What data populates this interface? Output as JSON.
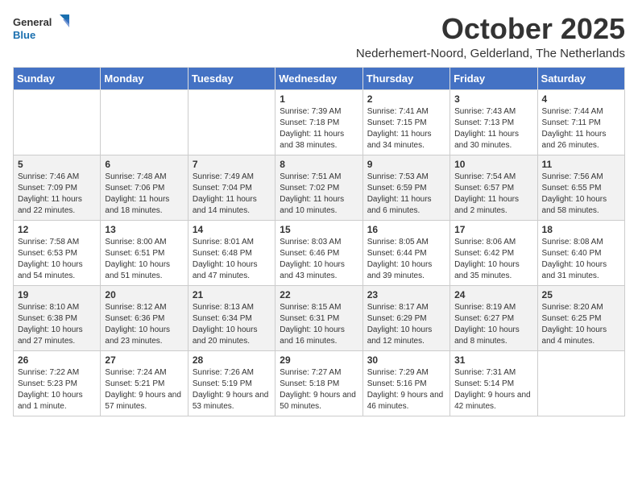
{
  "header": {
    "logo_general": "General",
    "logo_blue": "Blue",
    "month_title": "October 2025",
    "subtitle": "Nederhemert-Noord, Gelderland, The Netherlands"
  },
  "days_of_week": [
    "Sunday",
    "Monday",
    "Tuesday",
    "Wednesday",
    "Thursday",
    "Friday",
    "Saturday"
  ],
  "weeks": [
    [
      {
        "day": "",
        "info": ""
      },
      {
        "day": "",
        "info": ""
      },
      {
        "day": "",
        "info": ""
      },
      {
        "day": "1",
        "info": "Sunrise: 7:39 AM\nSunset: 7:18 PM\nDaylight: 11 hours and 38 minutes."
      },
      {
        "day": "2",
        "info": "Sunrise: 7:41 AM\nSunset: 7:15 PM\nDaylight: 11 hours and 34 minutes."
      },
      {
        "day": "3",
        "info": "Sunrise: 7:43 AM\nSunset: 7:13 PM\nDaylight: 11 hours and 30 minutes."
      },
      {
        "day": "4",
        "info": "Sunrise: 7:44 AM\nSunset: 7:11 PM\nDaylight: 11 hours and 26 minutes."
      }
    ],
    [
      {
        "day": "5",
        "info": "Sunrise: 7:46 AM\nSunset: 7:09 PM\nDaylight: 11 hours and 22 minutes."
      },
      {
        "day": "6",
        "info": "Sunrise: 7:48 AM\nSunset: 7:06 PM\nDaylight: 11 hours and 18 minutes."
      },
      {
        "day": "7",
        "info": "Sunrise: 7:49 AM\nSunset: 7:04 PM\nDaylight: 11 hours and 14 minutes."
      },
      {
        "day": "8",
        "info": "Sunrise: 7:51 AM\nSunset: 7:02 PM\nDaylight: 11 hours and 10 minutes."
      },
      {
        "day": "9",
        "info": "Sunrise: 7:53 AM\nSunset: 6:59 PM\nDaylight: 11 hours and 6 minutes."
      },
      {
        "day": "10",
        "info": "Sunrise: 7:54 AM\nSunset: 6:57 PM\nDaylight: 11 hours and 2 minutes."
      },
      {
        "day": "11",
        "info": "Sunrise: 7:56 AM\nSunset: 6:55 PM\nDaylight: 10 hours and 58 minutes."
      }
    ],
    [
      {
        "day": "12",
        "info": "Sunrise: 7:58 AM\nSunset: 6:53 PM\nDaylight: 10 hours and 54 minutes."
      },
      {
        "day": "13",
        "info": "Sunrise: 8:00 AM\nSunset: 6:51 PM\nDaylight: 10 hours and 51 minutes."
      },
      {
        "day": "14",
        "info": "Sunrise: 8:01 AM\nSunset: 6:48 PM\nDaylight: 10 hours and 47 minutes."
      },
      {
        "day": "15",
        "info": "Sunrise: 8:03 AM\nSunset: 6:46 PM\nDaylight: 10 hours and 43 minutes."
      },
      {
        "day": "16",
        "info": "Sunrise: 8:05 AM\nSunset: 6:44 PM\nDaylight: 10 hours and 39 minutes."
      },
      {
        "day": "17",
        "info": "Sunrise: 8:06 AM\nSunset: 6:42 PM\nDaylight: 10 hours and 35 minutes."
      },
      {
        "day": "18",
        "info": "Sunrise: 8:08 AM\nSunset: 6:40 PM\nDaylight: 10 hours and 31 minutes."
      }
    ],
    [
      {
        "day": "19",
        "info": "Sunrise: 8:10 AM\nSunset: 6:38 PM\nDaylight: 10 hours and 27 minutes."
      },
      {
        "day": "20",
        "info": "Sunrise: 8:12 AM\nSunset: 6:36 PM\nDaylight: 10 hours and 23 minutes."
      },
      {
        "day": "21",
        "info": "Sunrise: 8:13 AM\nSunset: 6:34 PM\nDaylight: 10 hours and 20 minutes."
      },
      {
        "day": "22",
        "info": "Sunrise: 8:15 AM\nSunset: 6:31 PM\nDaylight: 10 hours and 16 minutes."
      },
      {
        "day": "23",
        "info": "Sunrise: 8:17 AM\nSunset: 6:29 PM\nDaylight: 10 hours and 12 minutes."
      },
      {
        "day": "24",
        "info": "Sunrise: 8:19 AM\nSunset: 6:27 PM\nDaylight: 10 hours and 8 minutes."
      },
      {
        "day": "25",
        "info": "Sunrise: 8:20 AM\nSunset: 6:25 PM\nDaylight: 10 hours and 4 minutes."
      }
    ],
    [
      {
        "day": "26",
        "info": "Sunrise: 7:22 AM\nSunset: 5:23 PM\nDaylight: 10 hours and 1 minute."
      },
      {
        "day": "27",
        "info": "Sunrise: 7:24 AM\nSunset: 5:21 PM\nDaylight: 9 hours and 57 minutes."
      },
      {
        "day": "28",
        "info": "Sunrise: 7:26 AM\nSunset: 5:19 PM\nDaylight: 9 hours and 53 minutes."
      },
      {
        "day": "29",
        "info": "Sunrise: 7:27 AM\nSunset: 5:18 PM\nDaylight: 9 hours and 50 minutes."
      },
      {
        "day": "30",
        "info": "Sunrise: 7:29 AM\nSunset: 5:16 PM\nDaylight: 9 hours and 46 minutes."
      },
      {
        "day": "31",
        "info": "Sunrise: 7:31 AM\nSunset: 5:14 PM\nDaylight: 9 hours and 42 minutes."
      },
      {
        "day": "",
        "info": ""
      }
    ]
  ]
}
